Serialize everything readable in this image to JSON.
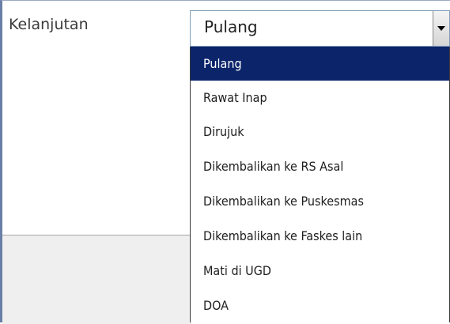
{
  "form": {
    "label": "Kelanjutan"
  },
  "combo": {
    "value": "Pulang"
  },
  "dropdown": {
    "items": [
      {
        "label": "Pulang",
        "selected": true
      },
      {
        "label": "Rawat Inap",
        "selected": false
      },
      {
        "label": "Dirujuk",
        "selected": false
      },
      {
        "label": "Dikembalikan ke RS Asal",
        "selected": false
      },
      {
        "label": "Dikembalikan ke Puskesmas",
        "selected": false
      },
      {
        "label": "Dikembalikan ke Faskes lain",
        "selected": false
      },
      {
        "label": "Mati di UGD",
        "selected": false
      },
      {
        "label": "DOA",
        "selected": false
      }
    ]
  },
  "colors": {
    "selection": "#0b246a",
    "combo_border": "#7f9db9"
  }
}
